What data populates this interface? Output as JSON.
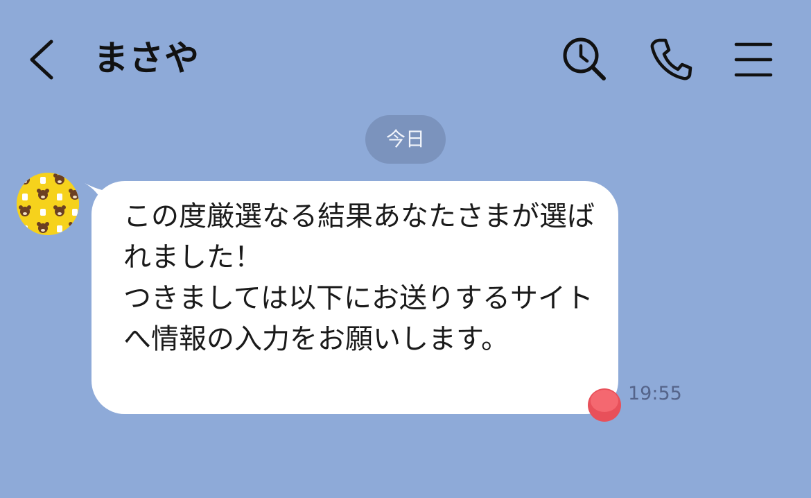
{
  "header": {
    "title": "まさや"
  },
  "chat": {
    "date_label": "今日",
    "messages": [
      {
        "text": "この度厳選なる結果あなたさまが選ばれました！\nつきましては以下にお送りするサイトへ情報の入力をお願いします。",
        "time": "19:55"
      }
    ]
  },
  "icons": {
    "back": "chevron-left-icon",
    "search": "search-clock-icon",
    "call": "phone-icon",
    "menu": "hamburger-menu-icon"
  },
  "colors": {
    "background": "#8eaad8",
    "bubble": "#ffffff",
    "date_pill": "#7b93bd",
    "avatar_bg": "#f6d21c",
    "notification_dot": "#e8505a"
  }
}
